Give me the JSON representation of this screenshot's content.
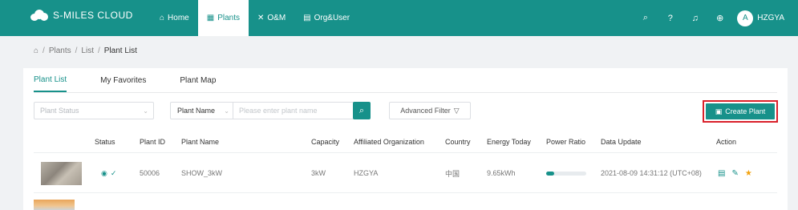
{
  "app": {
    "name": "S-MILES CLOUD"
  },
  "nav": [
    {
      "label": "Home",
      "icon": "home-icon",
      "active": false
    },
    {
      "label": "Plants",
      "icon": "plants-icon",
      "active": true
    },
    {
      "label": "O&M",
      "icon": "tools-icon",
      "active": false
    },
    {
      "label": "Org&User",
      "icon": "org-icon",
      "active": false
    }
  ],
  "topbar": {
    "user": "HZGYA",
    "avatar_letter": "A"
  },
  "breadcrumb": {
    "items": [
      "Plants",
      "List",
      "Plant List"
    ]
  },
  "tabs": [
    {
      "label": "Plant List",
      "active": true
    },
    {
      "label": "My Favorites",
      "active": false
    },
    {
      "label": "Plant Map",
      "active": false
    }
  ],
  "filters": {
    "status_placeholder": "Plant Status",
    "search_field": "Plant Name",
    "search_placeholder": "Please enter plant name",
    "advanced_label": "Advanced Filter"
  },
  "create_button": "Create Plant",
  "table": {
    "columns": [
      "Status",
      "Plant ID",
      "Plant Name",
      "Capacity",
      "Affiliated Organization",
      "Country",
      "Energy Today",
      "Power Ratio",
      "Data Update",
      "Action"
    ],
    "rows": [
      {
        "plant_id": "50006",
        "plant_name": "SHOW_3kW",
        "capacity": "3kW",
        "organization": "HZGYA",
        "country": "中国",
        "energy_today": "9.65kWh",
        "power_ratio": 0.2,
        "data_update": "2021-08-09 14:31:12 (UTC+08)"
      }
    ]
  },
  "colors": {
    "primary": "#17918a",
    "highlight": "#d9202a",
    "favorite": "#f2a20f"
  }
}
